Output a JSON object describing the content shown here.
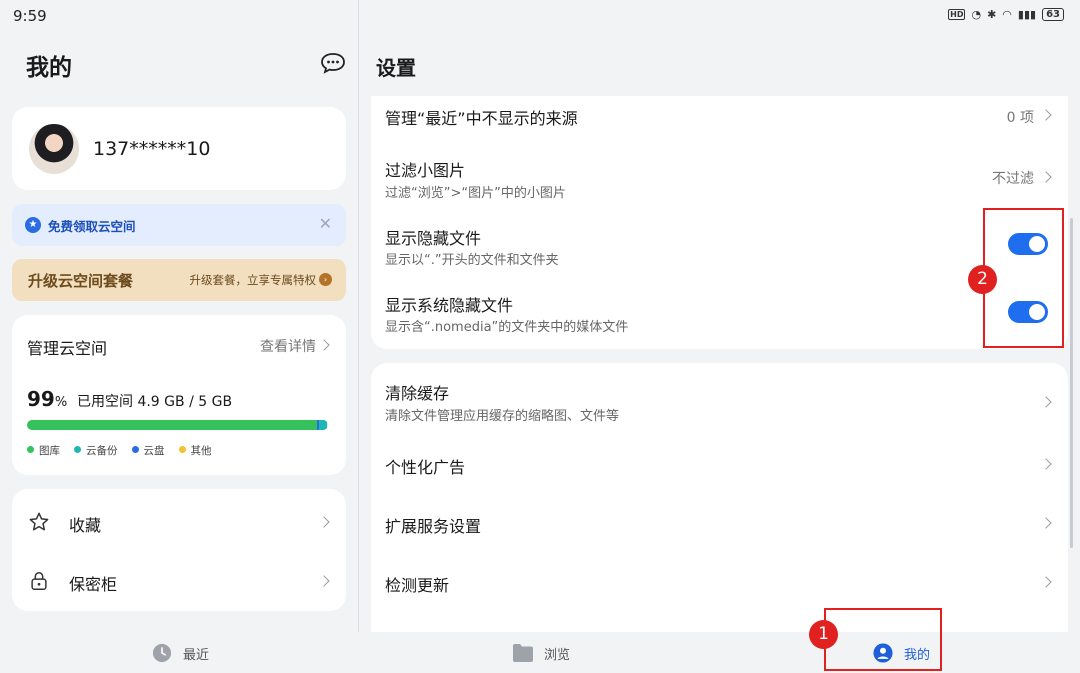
{
  "status": {
    "time": "9:59",
    "hd": "HD",
    "battery": "63"
  },
  "left": {
    "title": "我的",
    "profile": {
      "phone": "137******10"
    },
    "promo_free": {
      "text": "免费领取云空间"
    },
    "promo_upgrade": {
      "text": "升级云空间套餐",
      "sub": "升级套餐，立享专属特权"
    },
    "cloud": {
      "title": "管理云空间",
      "detail_link": "查看详情",
      "percent": "99",
      "percent_sign": "%",
      "used_text": "已用空间 4.9 GB / 5 GB",
      "used_fraction": 0.99,
      "legend": [
        {
          "label": "图库",
          "color": "#35c25a"
        },
        {
          "label": "云备份",
          "color": "#1fb6b6"
        },
        {
          "label": "云盘",
          "color": "#2a6de2"
        },
        {
          "label": "其他",
          "color": "#f2c233"
        }
      ]
    },
    "items": [
      {
        "label": "收藏",
        "icon": "star-icon"
      },
      {
        "label": "保密柜",
        "icon": "lock-icon"
      }
    ]
  },
  "right": {
    "title": "设置",
    "rows": [
      {
        "title": "管理“最近”中不显示的来源",
        "value": "0 项"
      },
      {
        "title": "过滤小图片",
        "desc": "过滤“浏览”>“图片”中的小图片",
        "value": "不过滤"
      },
      {
        "title": "显示隐藏文件",
        "desc": "显示以“.”开头的文件和文件夹",
        "toggle": true
      },
      {
        "title": "显示系统隐藏文件",
        "desc": "显示含“.nomedia”的文件夹中的媒体文件",
        "toggle": true
      },
      {
        "title": "清除缓存",
        "desc": "清除文件管理应用缓存的缩略图、文件等"
      },
      {
        "title": "个性化广告"
      },
      {
        "title": "扩展服务设置"
      },
      {
        "title": "检测更新"
      }
    ]
  },
  "annotations": {
    "badge1": "1",
    "badge2": "2"
  },
  "tabs": [
    {
      "label": "最近",
      "icon": "clock-icon"
    },
    {
      "label": "浏览",
      "icon": "folder-icon"
    },
    {
      "label": "我的",
      "icon": "person-icon"
    }
  ],
  "colors": {
    "accent": "#1f6ef0",
    "annotation": "#e0211f"
  }
}
